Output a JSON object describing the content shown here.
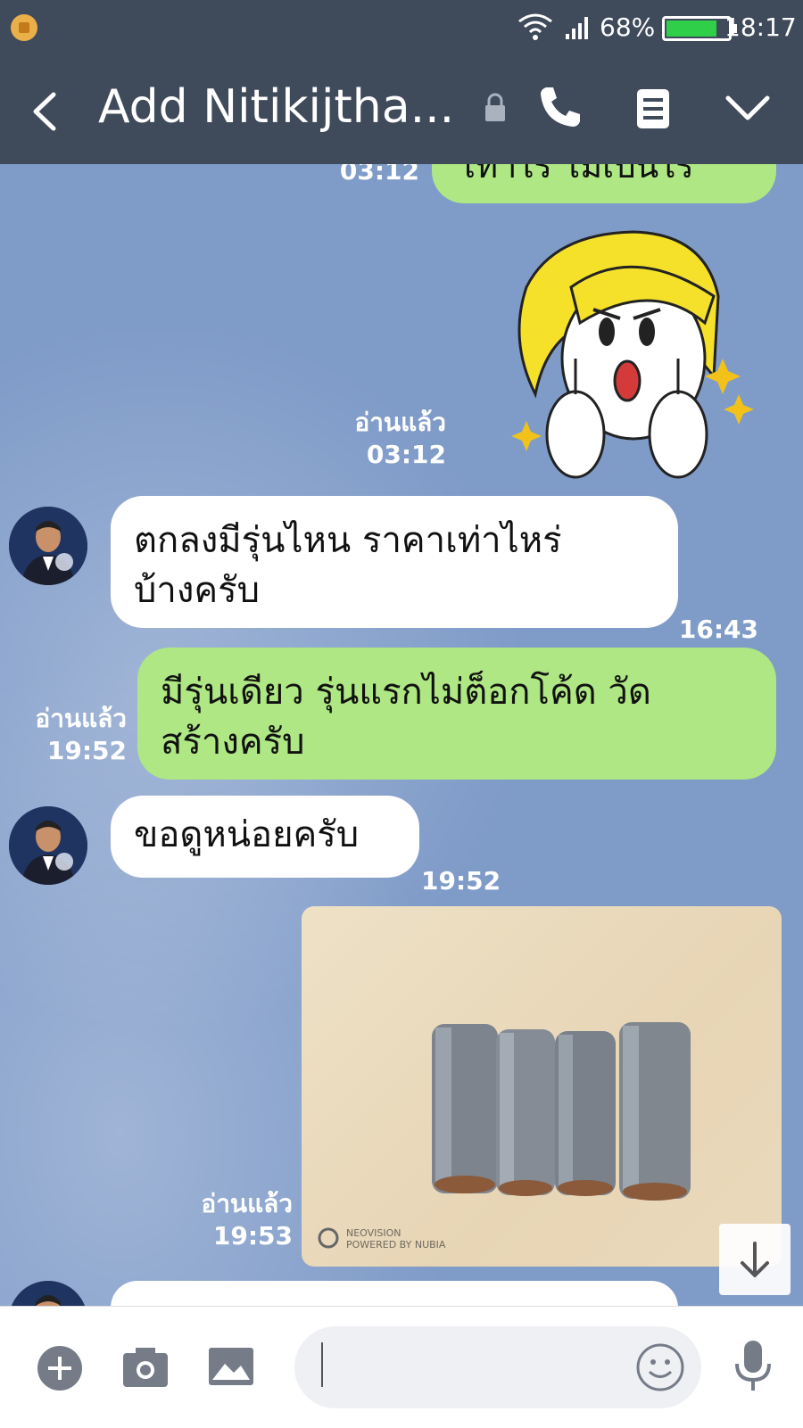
{
  "status_bar": {
    "battery_percent": "68%",
    "time": "18:17"
  },
  "header": {
    "title": "Add Nitikijtha..."
  },
  "messages": {
    "top_time": "03:12",
    "top_text": "เท่าไร ไม่เป็นไร",
    "sticker_read": "อ่านแล้ว",
    "sticker_time": "03:12",
    "m1_text_line1": "ตกลงมีรุ่นไหน ราคาเท่าไหร่",
    "m1_text_line2": "บ้างครับ",
    "m1_time": "16:43",
    "m2_text_line1": "มีรุ่นเดียว รุ่นแรกไม่ต็อกโค้ด วัด",
    "m2_text_line2": "สร้างครับ",
    "m2_read": "อ่านแล้ว",
    "m2_time": "19:52",
    "m3_text": "ขอดูหน่อยครับ",
    "m3_time": "19:52",
    "photo_watermark_line1": "NEOVISION",
    "photo_watermark_line2": "POWERED BY NUBIA",
    "photo_read": "อ่านแล้ว",
    "photo_time": "19:53"
  },
  "colors": {
    "header_bg": "#3f4a5b",
    "chat_bg": "#7f9bc8",
    "incoming_bubble": "#ffffff",
    "outgoing_bubble": "#aee783"
  }
}
